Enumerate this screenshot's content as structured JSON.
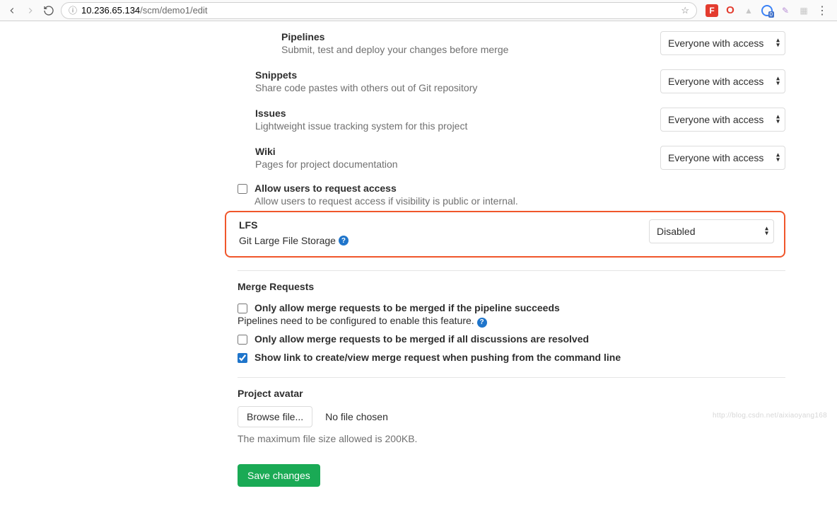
{
  "browser": {
    "url_host": "10.236.65.134",
    "url_path": "/scm/demo1/edit"
  },
  "features": {
    "pipelines": {
      "title": "Pipelines",
      "desc": "Submit, test and deploy your changes before merge",
      "value": "Everyone with access"
    },
    "snippets": {
      "title": "Snippets",
      "desc": "Share code pastes with others out of Git repository",
      "value": "Everyone with access"
    },
    "issues": {
      "title": "Issues",
      "desc": "Lightweight issue tracking system for this project",
      "value": "Everyone with access"
    },
    "wiki": {
      "title": "Wiki",
      "desc": "Pages for project documentation",
      "value": "Everyone with access"
    }
  },
  "request_access": {
    "label": "Allow users to request access",
    "desc": "Allow users to request access if visibility is public or internal."
  },
  "lfs": {
    "title": "LFS",
    "desc": "Git Large File Storage",
    "value": "Disabled"
  },
  "merge_requests": {
    "heading": "Merge Requests",
    "opt1": {
      "label": "Only allow merge requests to be merged if the pipeline succeeds",
      "desc": "Pipelines need to be configured to enable this feature."
    },
    "opt2": {
      "label": "Only allow merge requests to be merged if all discussions are resolved"
    },
    "opt3": {
      "label": "Show link to create/view merge request when pushing from the command line"
    }
  },
  "avatar": {
    "heading": "Project avatar",
    "browse": "Browse file...",
    "status": "No file chosen",
    "hint": "The maximum file size allowed is 200KB."
  },
  "save_label": "Save changes",
  "watermark": "http://blog.csdn.net/aixiaoyang168"
}
